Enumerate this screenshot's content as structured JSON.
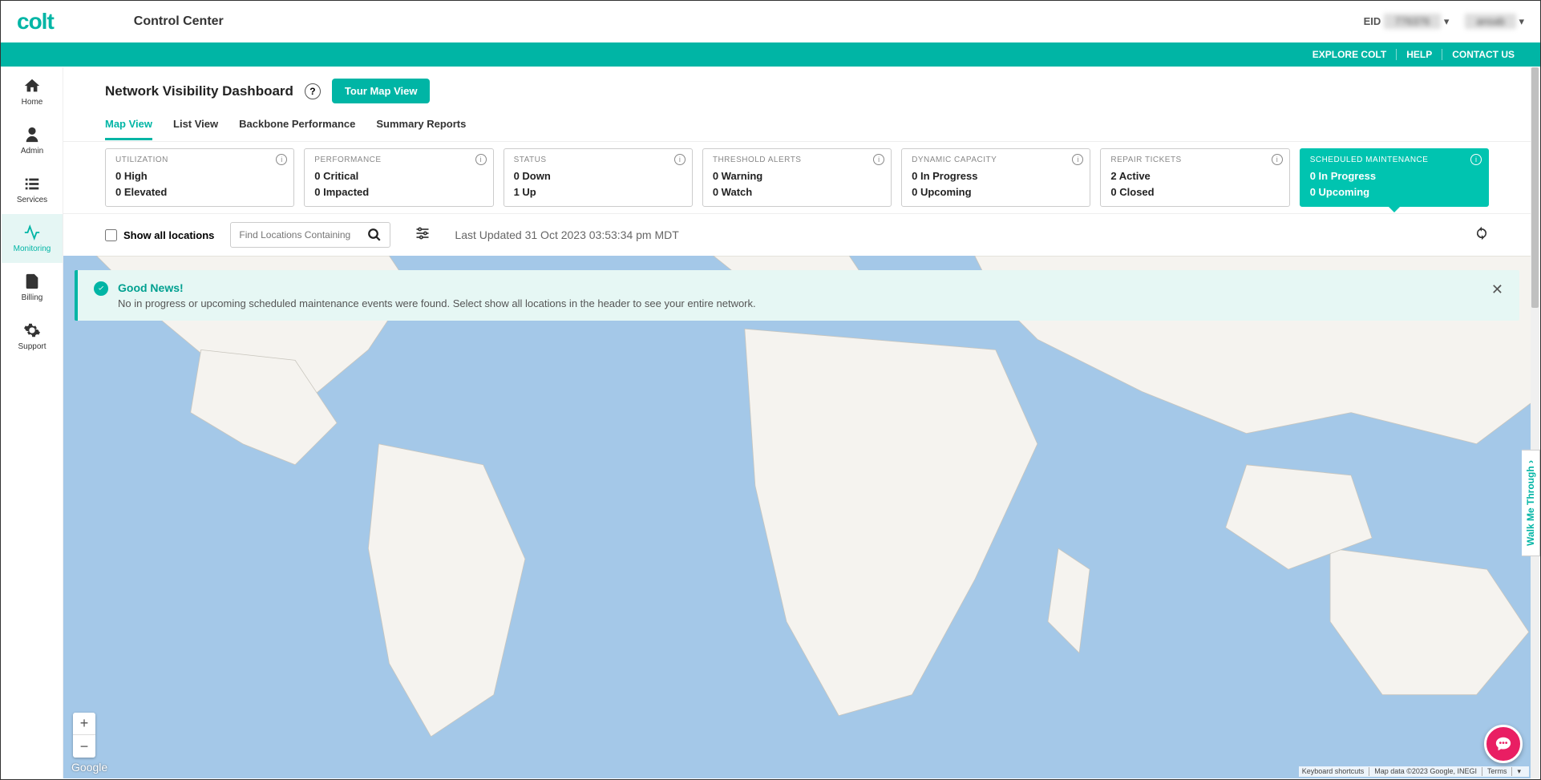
{
  "header": {
    "logo": "colt",
    "app_title": "Control Center",
    "eid_label": "EID",
    "eid_value": "776376",
    "user_value": "ansab"
  },
  "teal_links": [
    "EXPLORE COLT",
    "HELP",
    "CONTACT US"
  ],
  "sidebar": {
    "items": [
      {
        "label": "Home"
      },
      {
        "label": "Admin"
      },
      {
        "label": "Services"
      },
      {
        "label": "Monitoring"
      },
      {
        "label": "Billing"
      },
      {
        "label": "Support"
      }
    ]
  },
  "page": {
    "title": "Network Visibility Dashboard",
    "tour_btn": "Tour Map View"
  },
  "tabs": [
    "Map View",
    "List View",
    "Backbone Performance",
    "Summary Reports"
  ],
  "cards": [
    {
      "title": "UTILIZATION",
      "line1": "0 High",
      "line2": "0 Elevated"
    },
    {
      "title": "PERFORMANCE",
      "line1": "0 Critical",
      "line2": "0 Impacted"
    },
    {
      "title": "STATUS",
      "line1": "0 Down",
      "line2": "1 Up"
    },
    {
      "title": "THRESHOLD ALERTS",
      "line1": "0 Warning",
      "line2": "0 Watch"
    },
    {
      "title": "DYNAMIC CAPACITY",
      "line1": "0 In Progress",
      "line2": "0 Upcoming"
    },
    {
      "title": "REPAIR TICKETS",
      "line1": "2 Active",
      "line2": "0 Closed"
    },
    {
      "title": "SCHEDULED MAINTENANCE",
      "line1": "0 In Progress",
      "line2": "0 Upcoming"
    }
  ],
  "filter": {
    "show_all": "Show all locations",
    "search_placeholder": "Find Locations Containing",
    "last_updated": "Last Updated 31 Oct 2023 03:53:34 pm MDT"
  },
  "notification": {
    "title": "Good News!",
    "body": "No in progress or upcoming scheduled maintenance events were found. Select show all locations in the header to see your entire network."
  },
  "map": {
    "google": "Google",
    "footer": [
      "Keyboard shortcuts",
      "Map data ©2023 Google, INEGI",
      "Terms"
    ]
  },
  "walkme": "Walk Me Through"
}
